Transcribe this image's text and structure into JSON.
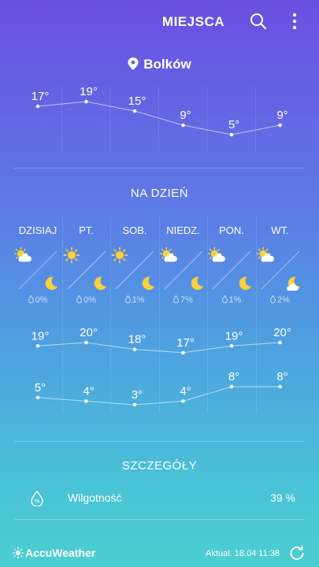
{
  "header": {
    "title": "MIEJSCA",
    "search_icon": "search-icon",
    "more_icon": "more-vert-icon"
  },
  "location": {
    "name": "Bolków",
    "icon": "location-pin-icon"
  },
  "hourly": {
    "temps": [
      "17°",
      "19°",
      "15°",
      "9°",
      "5°",
      "9°"
    ],
    "values": [
      17,
      19,
      15,
      9,
      5,
      9
    ]
  },
  "daily": {
    "title": "NA DZIEŃ",
    "days": [
      {
        "name": "DZISIAJ",
        "day_icon": "partly-cloudy-icon",
        "night_icon": "moon-icon",
        "precip": "0%",
        "high": "19°",
        "low": "5°"
      },
      {
        "name": "PT.",
        "day_icon": "sun-icon",
        "night_icon": "moon-icon",
        "precip": "0%",
        "high": "20°",
        "low": "4°"
      },
      {
        "name": "SOB.",
        "day_icon": "sun-icon",
        "night_icon": "moon-icon",
        "precip": "1%",
        "high": "18°",
        "low": "3°"
      },
      {
        "name": "NIEDZ.",
        "day_icon": "partly-cloudy-icon",
        "night_icon": "moon-icon",
        "precip": "7%",
        "high": "17°",
        "low": "4°"
      },
      {
        "name": "PON.",
        "day_icon": "partly-cloudy-icon",
        "night_icon": "moon-icon",
        "precip": "1%",
        "high": "19°",
        "low": "8°"
      },
      {
        "name": "WT.",
        "day_icon": "partly-cloudy-icon",
        "night_icon": "cloudy-moon-icon",
        "precip": "2%",
        "high": "20°",
        "low": "8°"
      }
    ],
    "high_values": [
      19,
      20,
      18,
      17,
      19,
      20
    ],
    "low_values": [
      5,
      4,
      3,
      4,
      8,
      8
    ]
  },
  "details": {
    "title": "SZCZEGÓŁY",
    "rows": [
      {
        "icon": "humidity-icon",
        "label": "Wilgotność",
        "value": "39 %"
      }
    ]
  },
  "footer": {
    "provider": "AccuWeather",
    "updated": "Aktual. 18.04 11:38",
    "refresh_icon": "refresh-icon"
  },
  "colors": {
    "bg_top": "#6a4fe0",
    "bg_bottom": "#4ccfd0",
    "sun": "#f7d23a",
    "moon": "#f7d23a",
    "text": "#ffffff"
  }
}
